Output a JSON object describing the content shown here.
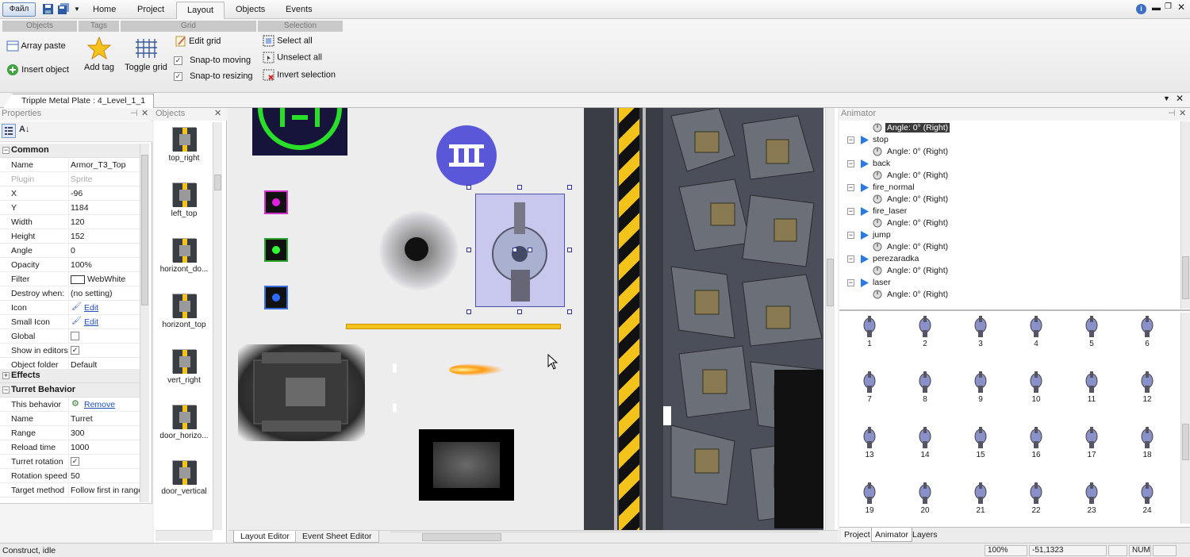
{
  "titlebar": {
    "file": "Файл",
    "tabs": [
      "Home",
      "Project",
      "Layout",
      "Objects",
      "Events"
    ],
    "active_tab": "Layout"
  },
  "ribbon": {
    "groups": [
      "Objects",
      "Tags",
      "Grid",
      "Selection"
    ],
    "array_paste": "Array paste",
    "insert_object": "Insert object",
    "add_tag": "Add tag",
    "toggle_grid": "Toggle grid",
    "edit_grid": "Edit grid",
    "snap_moving": "Snap-to moving",
    "snap_resizing": "Snap-to resizing",
    "select_all": "Select all",
    "unselect_all": "Unselect all",
    "invert_selection": "Invert selection"
  },
  "document_tab": "Tripple Metal Plate : 4_Level_1_1",
  "properties": {
    "title": "Properties",
    "common": "Common",
    "rows": [
      {
        "k": "Name",
        "v": "Armor_T3_Top"
      },
      {
        "k": "Plugin",
        "v": "Sprite"
      },
      {
        "k": "X",
        "v": "-96"
      },
      {
        "k": "Y",
        "v": "1184"
      },
      {
        "k": "Width",
        "v": "120"
      },
      {
        "k": "Height",
        "v": "152"
      },
      {
        "k": "Angle",
        "v": "0"
      },
      {
        "k": "Opacity",
        "v": "100%"
      },
      {
        "k": "Filter",
        "v": "WebWhite"
      },
      {
        "k": "Destroy when:",
        "v": "(no setting)"
      },
      {
        "k": "Icon",
        "v": "Edit"
      },
      {
        "k": "Small Icon",
        "v": "Edit"
      },
      {
        "k": "Global",
        "v": ""
      },
      {
        "k": "Show in editors",
        "v": "✓"
      },
      {
        "k": "Object folder",
        "v": "Default"
      }
    ],
    "effects": "Effects",
    "turret": "Turret Behavior",
    "turret_rows": [
      {
        "k": "This behavior",
        "v": "Remove"
      },
      {
        "k": "Name",
        "v": "Turret"
      },
      {
        "k": "Range",
        "v": "300"
      },
      {
        "k": "Reload time",
        "v": "1000"
      },
      {
        "k": "Turret rotation",
        "v": "✓"
      },
      {
        "k": "Rotation speed",
        "v": "50"
      },
      {
        "k": "Target method",
        "v": "Follow first in range"
      }
    ]
  },
  "objects": {
    "title": "Objects",
    "items": [
      "top_right",
      "left_top",
      "horizont_do...",
      "horizont_top",
      "vert_right",
      "door_horizo...",
      "door_vertical"
    ]
  },
  "editor_tabs": [
    "Layout Editor",
    "Event Sheet Editor"
  ],
  "animator": {
    "title": "Animator",
    "top_angle": "Angle: 0° (Right)",
    "anims": [
      {
        "name": "stop",
        "angle": "Angle: 0° (Right)"
      },
      {
        "name": "back",
        "angle": "Angle: 0° (Right)"
      },
      {
        "name": "fire_normal",
        "angle": "Angle: 0° (Right)"
      },
      {
        "name": "fire_laser",
        "angle": "Angle: 0° (Right)"
      },
      {
        "name": "jump",
        "angle": "Angle: 0° (Right)"
      },
      {
        "name": "perezaradka",
        "angle": "Angle: 0° (Right)"
      },
      {
        "name": "laser",
        "angle": "Angle: 0° (Right)"
      }
    ],
    "frames": [
      "1",
      "2",
      "3",
      "4",
      "5",
      "6",
      "7",
      "8",
      "9",
      "10",
      "11",
      "12",
      "13",
      "14",
      "15",
      "16",
      "17",
      "18",
      "19",
      "20",
      "21",
      "22",
      "23",
      "24"
    ],
    "bottom_tabs": [
      "Project",
      "Animator",
      "Layers"
    ]
  },
  "status": {
    "left": "Construct, idle",
    "zoom": "100%",
    "coords": "-51,1323",
    "num": "NUM"
  },
  "colors": {
    "accent": "#5a57d8",
    "green": "#2adf2a",
    "yellow": "#f3c31b"
  }
}
